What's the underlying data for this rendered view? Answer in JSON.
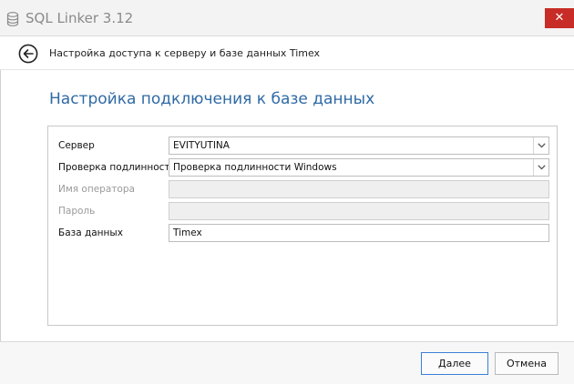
{
  "window": {
    "title": "SQL Linker 3.12",
    "close_glyph": "✕"
  },
  "nav": {
    "title": "Настройка доступа к серверу и базе данных Timex"
  },
  "page": {
    "heading": "Настройка подключения к базе данных"
  },
  "form": {
    "server_label": "Сервер",
    "server_value": "EVITYUTINA",
    "auth_label": "Проверка подлинности",
    "auth_value": "Проверка подлинности Windows",
    "user_label": "Имя оператора",
    "user_value": "",
    "password_label": "Пароль",
    "password_value": "",
    "database_label": "База данных",
    "database_value": "Timex"
  },
  "footer": {
    "next_label": "Далее",
    "cancel_label": "Отмена"
  },
  "colors": {
    "heading": "#2f6aa5",
    "close": "#c72c26",
    "primary_border": "#3c7fd8"
  },
  "icons": {
    "app": "database-icon",
    "back": "back-arrow-icon",
    "combo": "chevron-down-icon"
  }
}
